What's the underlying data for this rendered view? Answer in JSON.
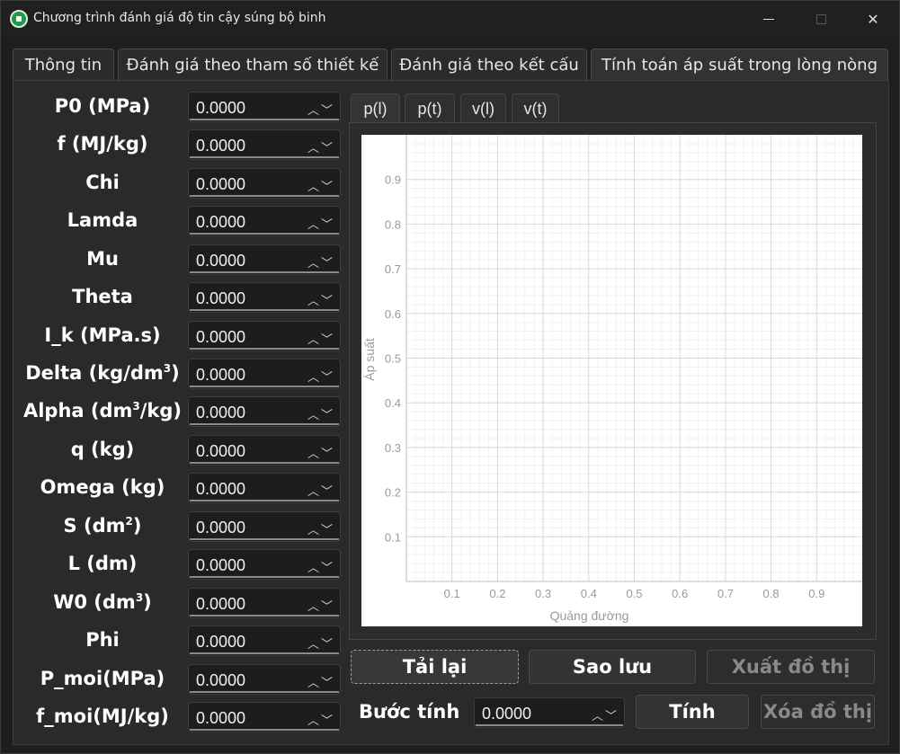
{
  "window": {
    "title": "Chương trình đánh giá độ tin cậy súng bộ binh",
    "minimize_glyph": "",
    "close_glyph": "✕"
  },
  "tabs": [
    {
      "label": "Thông tin"
    },
    {
      "label": "Đánh giá theo tham số thiết kế"
    },
    {
      "label": "Đánh giá theo kết cấu"
    },
    {
      "label": "Tính toán áp suất trong lòng nòng",
      "active": true
    }
  ],
  "params": [
    {
      "label": "P0 (MPa)",
      "value": "0.0000"
    },
    {
      "label": "f (MJ/kg)",
      "value": "0.0000"
    },
    {
      "label": "Chi",
      "value": "0.0000"
    },
    {
      "label": "Lamda",
      "value": "0.0000"
    },
    {
      "label": "Mu",
      "value": "0.0000"
    },
    {
      "label": "Theta",
      "value": "0.0000"
    },
    {
      "label": "I_k (MPa.s)",
      "value": "0.0000"
    },
    {
      "label_pre": "Delta (kg/dm",
      "sup": "3",
      "label_post": ")",
      "value": "0.0000"
    },
    {
      "label_pre": "Alpha (dm",
      "sup": "3",
      "label_post": "/kg)",
      "value": "0.0000"
    },
    {
      "label": "q (kg)",
      "value": "0.0000"
    },
    {
      "label": "Omega (kg)",
      "value": "0.0000"
    },
    {
      "label_pre": "S (dm",
      "sup": "2",
      "label_post": ")",
      "value": "0.0000"
    },
    {
      "label": "L (dm)",
      "value": "0.0000"
    },
    {
      "label_pre": "W0 (dm",
      "sup": "3",
      "label_post": ")",
      "value": "0.0000"
    },
    {
      "label": "Phi",
      "value": "0.0000"
    },
    {
      "label": "P_moi(MPa)",
      "value": "0.0000"
    },
    {
      "label": "f_moi(MJ/kg)",
      "value": "0.0000"
    }
  ],
  "spin_arrows": "︿﹀",
  "chart_tabs": [
    {
      "label": "p(l)",
      "active": true
    },
    {
      "label": "p(t)"
    },
    {
      "label": "v(l)"
    },
    {
      "label": "v(t)"
    }
  ],
  "chart_data": {
    "type": "line",
    "title": "",
    "xlabel": "Quảng đường",
    "ylabel": "Áp suất",
    "xlim": [
      0,
      1
    ],
    "ylim": [
      0,
      1
    ],
    "xticks": [
      "0.1",
      "0.2",
      "0.3",
      "0.4",
      "0.5",
      "0.6",
      "0.7",
      "0.8",
      "0.9"
    ],
    "yticks": [
      "0.1",
      "0.2",
      "0.3",
      "0.4",
      "0.5",
      "0.6",
      "0.7",
      "0.8",
      "0.9"
    ],
    "grid": true,
    "series": []
  },
  "buttons": {
    "reload": "Tải lại",
    "backup": "Sao lưu",
    "export": "Xuất đồ thị",
    "compute": "Tính",
    "clear": "Xóa đồ thị"
  },
  "step": {
    "label": "Bước tính",
    "value": "0.0000"
  }
}
